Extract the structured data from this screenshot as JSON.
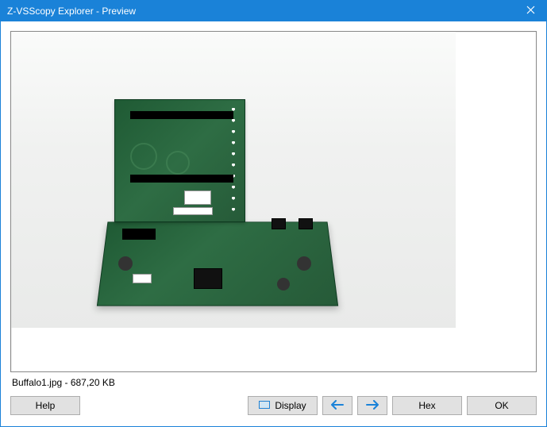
{
  "window": {
    "title": "Z-VSScopy Explorer - Preview"
  },
  "status": {
    "text": "Buffalo1.jpg - 687,20 KB"
  },
  "buttons": {
    "help": "Help",
    "display": "Display",
    "hex": "Hex",
    "ok": "OK"
  }
}
